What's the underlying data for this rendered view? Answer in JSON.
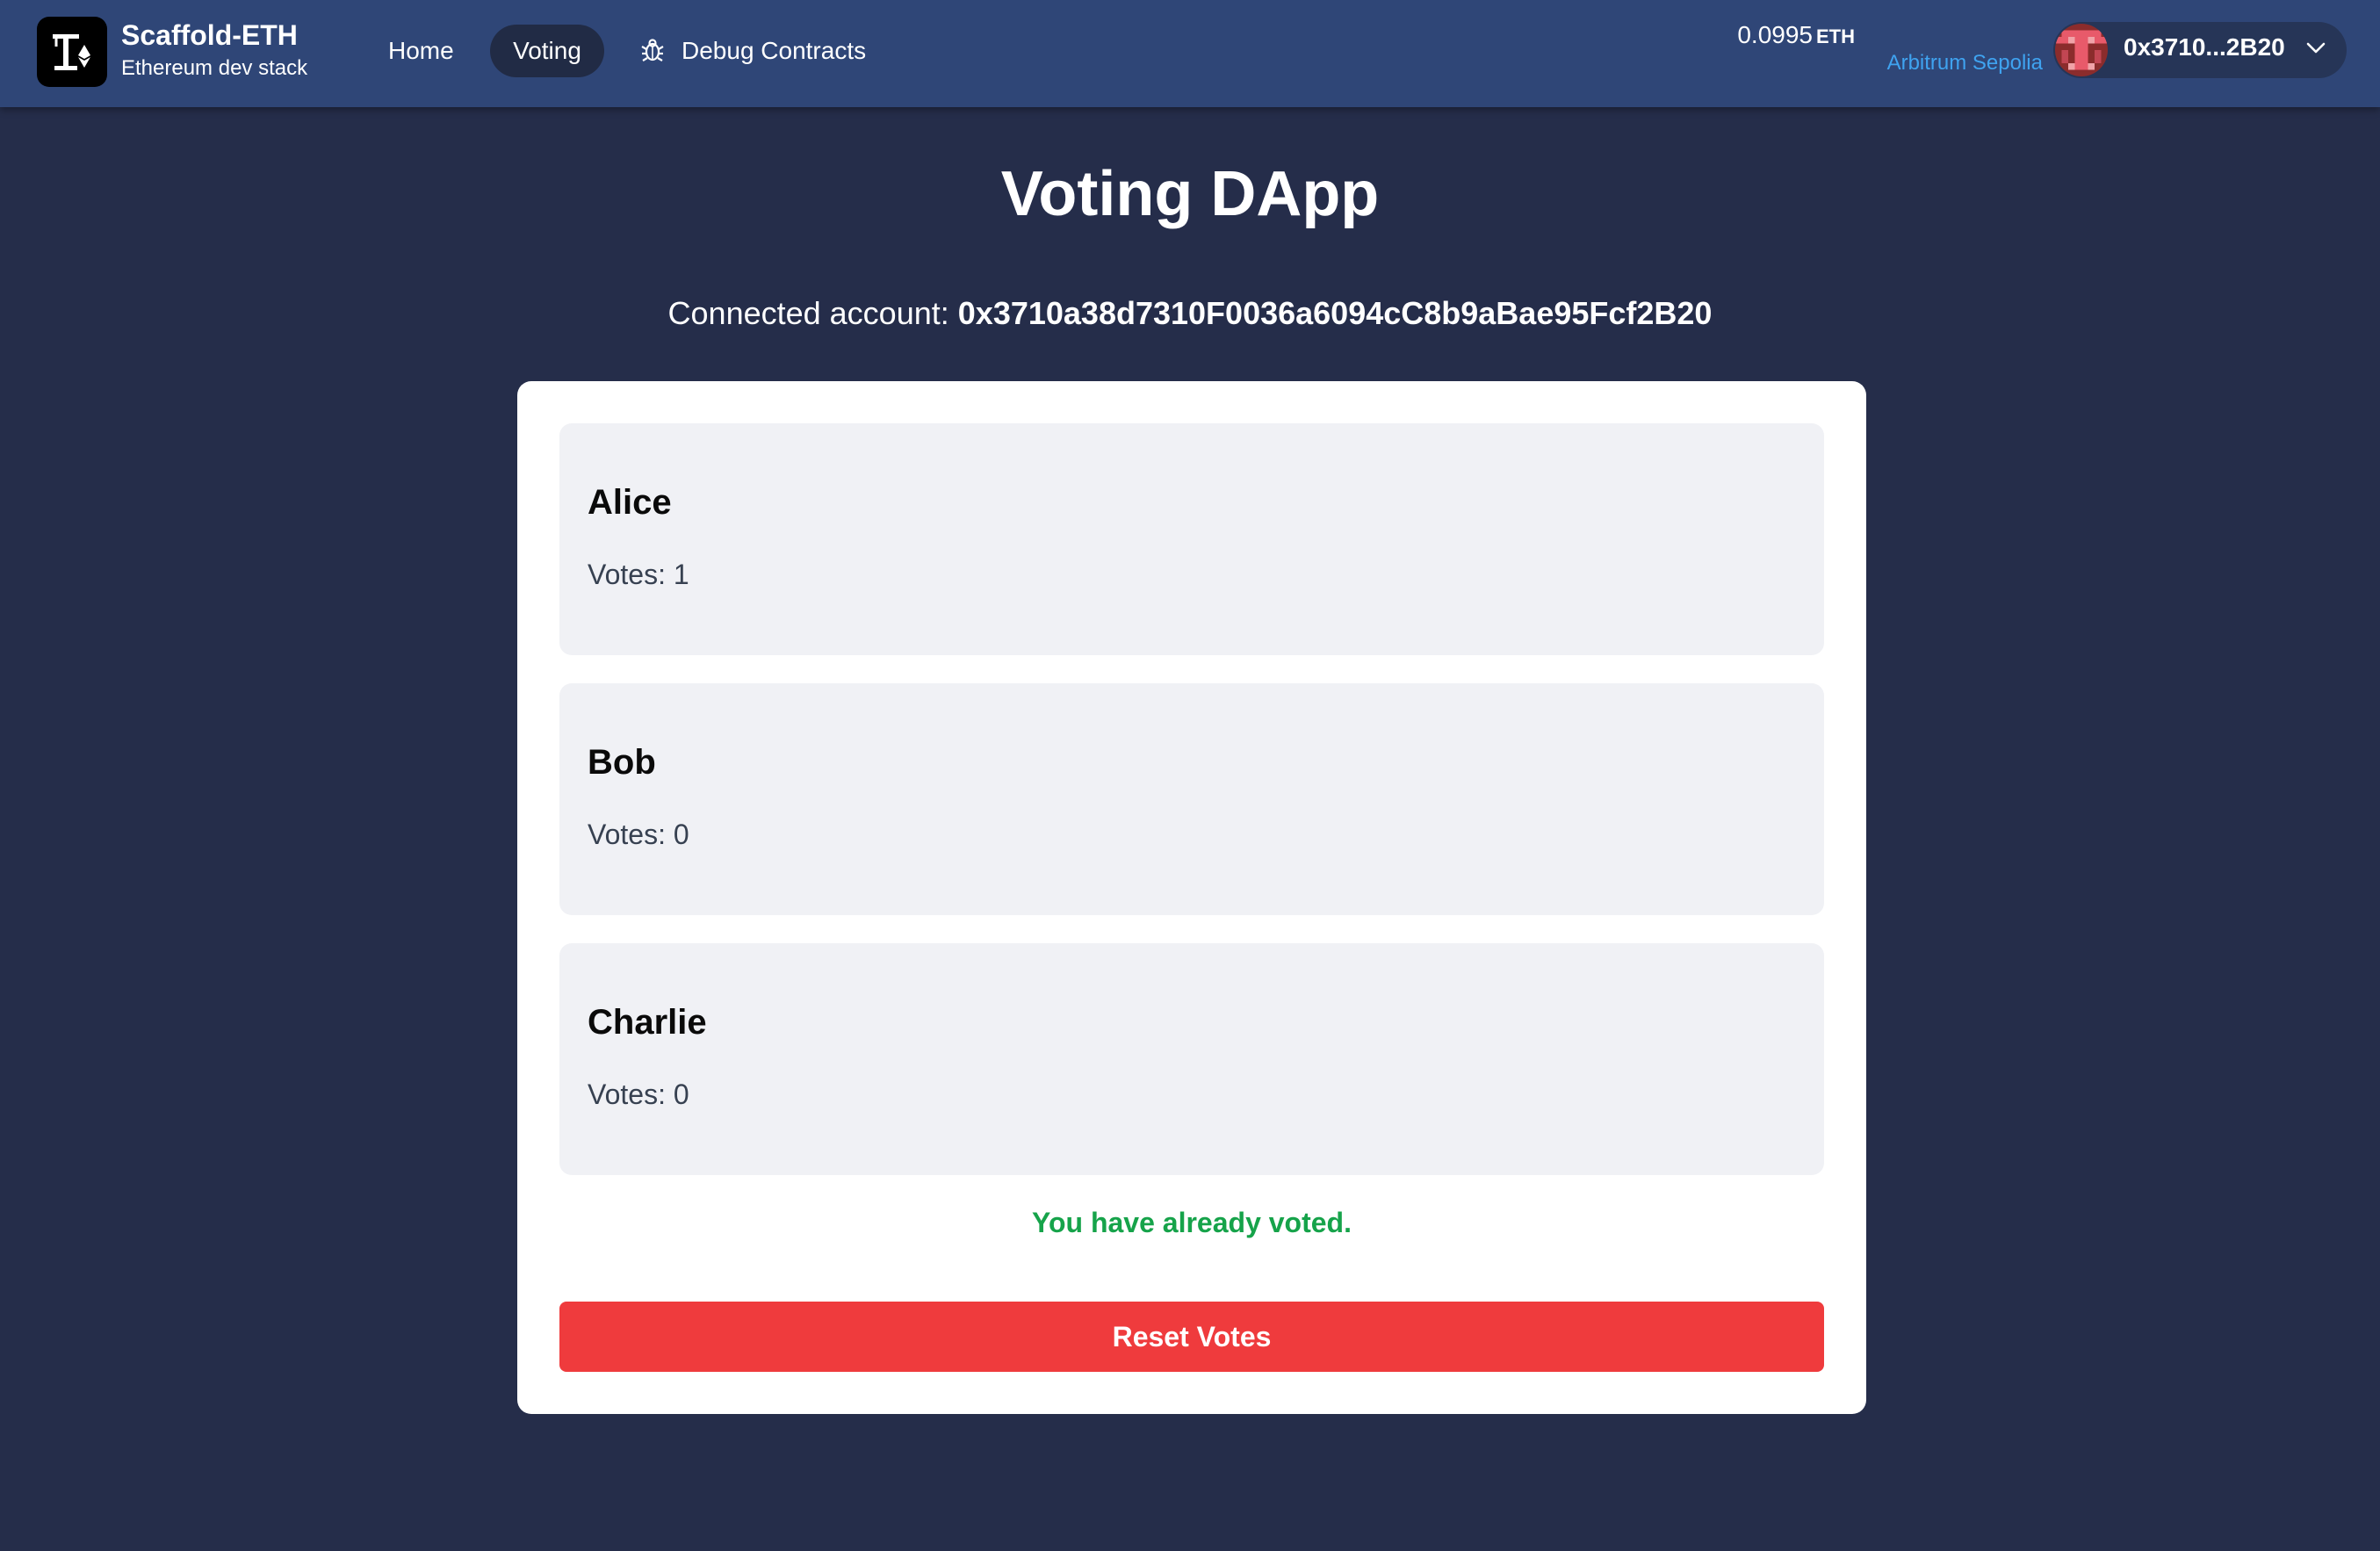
{
  "header": {
    "brand_title": "Scaffold-ETH",
    "brand_subtitle": "Ethereum dev stack",
    "nav": {
      "home": "Home",
      "voting": "Voting",
      "debug": "Debug Contracts"
    },
    "balance_value": "0.0995",
    "balance_unit": "ETH",
    "network": "Arbitrum Sepolia",
    "wallet_address": "0x3710...2B20"
  },
  "main": {
    "title": "Voting DApp",
    "connected_label": "Connected account:",
    "connected_address": "0x3710a38d7310F0036a6094cC8b9aBae95Fcf2B20",
    "candidates": [
      {
        "name": "Alice",
        "votes": "Votes: 1"
      },
      {
        "name": "Bob",
        "votes": "Votes: 0"
      },
      {
        "name": "Charlie",
        "votes": "Votes: 0"
      }
    ],
    "status_message": "You have already voted.",
    "reset_button": "Reset Votes"
  },
  "colors": {
    "background": "#252d4a",
    "header": "#2f4677",
    "network_link": "#3fa3f0",
    "success": "#16a34a",
    "danger": "#ef3b3d"
  },
  "icons": [
    "scaffold-logo-icon",
    "bug-icon",
    "blockie-avatar-icon",
    "chevron-down-icon"
  ]
}
